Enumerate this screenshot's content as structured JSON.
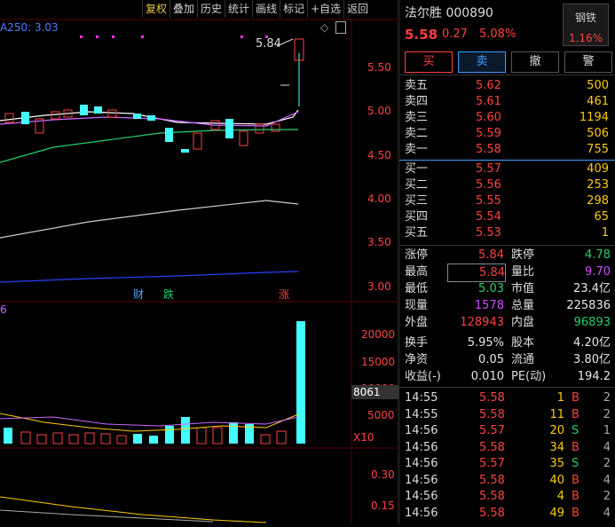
{
  "toolbar": {
    "items": [
      "复权",
      "叠加",
      "历史",
      "统计",
      "画线",
      "标记",
      "+自选",
      "返回"
    ]
  },
  "chart": {
    "ma_label": "A250: 3.03",
    "high_label": "5.84",
    "price_axis": [
      "5.50",
      "5.00",
      "4.50",
      "4.00",
      "3.50",
      "3.00"
    ],
    "events": [
      "财",
      "跌",
      "涨"
    ],
    "vol_label": "6",
    "vol_axis": [
      "20000",
      "15000",
      "10000",
      "5000"
    ],
    "vol_current": "8061",
    "vol_unit": "X10",
    "ind_axis": [
      "0.30",
      "0.15"
    ]
  },
  "stock": {
    "name_code": "法尔胜 000890",
    "price": "5.58",
    "change": "0.27",
    "pct": "5.08%",
    "sector": "钢铁",
    "sector_pct": "1.16%"
  },
  "buttons": [
    "买",
    "卖",
    "撤",
    "警"
  ],
  "asks": [
    {
      "label": "卖五",
      "price": "5.62",
      "vol": "500"
    },
    {
      "label": "卖四",
      "price": "5.61",
      "vol": "461"
    },
    {
      "label": "卖三",
      "price": "5.60",
      "vol": "1194"
    },
    {
      "label": "卖二",
      "price": "5.59",
      "vol": "506"
    },
    {
      "label": "卖一",
      "price": "5.58",
      "vol": "755"
    }
  ],
  "bids": [
    {
      "label": "买一",
      "price": "5.57",
      "vol": "409"
    },
    {
      "label": "买二",
      "price": "5.56",
      "vol": "253"
    },
    {
      "label": "买三",
      "price": "5.55",
      "vol": "298"
    },
    {
      "label": "买四",
      "price": "5.54",
      "vol": "65"
    },
    {
      "label": "买五",
      "price": "5.53",
      "vol": "1"
    }
  ],
  "info": [
    {
      "l": "涨停",
      "a": "5.84",
      "ac": "red",
      "l2": "跌停",
      "b": "4.78",
      "bc": "green"
    },
    {
      "l": "最高",
      "a": "5.84",
      "ac": "red",
      "l2": "量比",
      "b": "9.70",
      "bc": "purple"
    },
    {
      "l": "最低",
      "a": "5.03",
      "ac": "green",
      "l2": "市值",
      "b": "23.4亿",
      "bc": "white"
    },
    {
      "l": "现量",
      "a": "1578",
      "ac": "purple",
      "l2": "总量",
      "b": "225836",
      "bc": "white"
    },
    {
      "l": "外盘",
      "a": "128943",
      "ac": "red",
      "l2": "内盘",
      "b": "96893",
      "bc": "green"
    },
    {
      "l": "换手",
      "a": "5.95%",
      "ac": "white",
      "l2": "股本",
      "b": "4.20亿",
      "bc": "white"
    },
    {
      "l": "净资",
      "a": "0.05",
      "ac": "white",
      "l2": "流通",
      "b": "3.80亿",
      "bc": "white"
    },
    {
      "l": "收益(-)",
      "a": "0.010",
      "ac": "white",
      "l2": "PE(动)",
      "b": "194.2",
      "bc": "white"
    }
  ],
  "trades": [
    {
      "t": "14:55",
      "p": "5.58",
      "q": "1",
      "s": "B",
      "n": "2"
    },
    {
      "t": "14:55",
      "p": "5.58",
      "q": "11",
      "s": "B",
      "n": "2"
    },
    {
      "t": "14:56",
      "p": "5.57",
      "q": "20",
      "s": "S",
      "n": "1"
    },
    {
      "t": "14:56",
      "p": "5.58",
      "q": "34",
      "s": "B",
      "n": "4"
    },
    {
      "t": "14:56",
      "p": "5.57",
      "q": "35",
      "s": "S",
      "n": "2"
    },
    {
      "t": "14:56",
      "p": "5.58",
      "q": "40",
      "s": "B",
      "n": "4"
    },
    {
      "t": "14:56",
      "p": "5.58",
      "q": "4",
      "s": "B",
      "n": "2"
    },
    {
      "t": "14:56",
      "p": "5.58",
      "q": "49",
      "s": "B",
      "n": "4"
    }
  ],
  "colors": {
    "up": "#ff4040",
    "down": "#21d16a",
    "vol_up": "#ff4040",
    "vol_down": "#4ff"
  }
}
